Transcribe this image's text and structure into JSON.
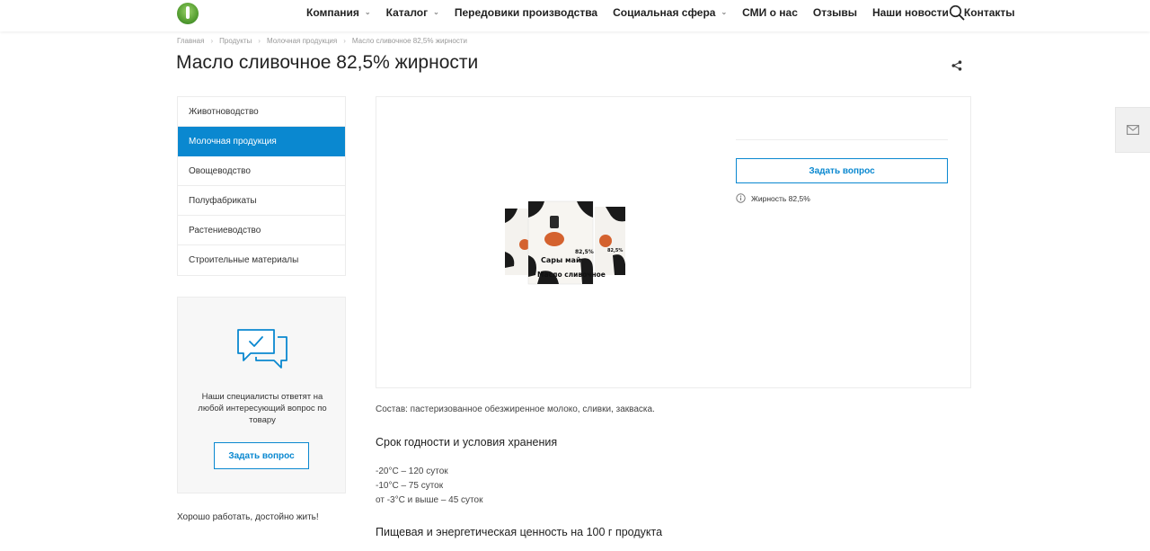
{
  "header": {
    "nav": [
      {
        "label": "Компания",
        "dropdown": true
      },
      {
        "label": "Каталог",
        "dropdown": true
      },
      {
        "label": "Передовики производства",
        "dropdown": false
      },
      {
        "label": "Социальная сфера",
        "dropdown": true
      },
      {
        "label": "СМИ о нас",
        "dropdown": false
      },
      {
        "label": "Отзывы",
        "dropdown": false
      },
      {
        "label": "Наши новости",
        "dropdown": false
      },
      {
        "label": "Контакты",
        "dropdown": false
      }
    ]
  },
  "breadcrumb": [
    "Главная",
    "Продукты",
    "Молочная продукция",
    "Масло сливочное 82,5% жирности"
  ],
  "page_title": "Масло сливочное 82,5% жирности",
  "sidebar": {
    "items": [
      {
        "label": "Животноводство",
        "active": false
      },
      {
        "label": "Молочная продукция",
        "active": true
      },
      {
        "label": "Овощеводство",
        "active": false
      },
      {
        "label": "Полуфабрикаты",
        "active": false
      },
      {
        "label": "Растениеводство",
        "active": false
      },
      {
        "label": "Строительные материалы",
        "active": false
      }
    ],
    "ask_text": "Наши специалисты ответят на любой интересующий вопрос по товару",
    "ask_button": "Задать вопрос",
    "slogan": "Хорошо работать, достойно жить!"
  },
  "product": {
    "ask_button": "Задать вопрос",
    "property": "Жирность 82,5%",
    "image_text": {
      "brand": "Сары май",
      "name": "Масло сливочное",
      "percent": "82,5%"
    }
  },
  "description": {
    "composition": "Состав: пастеризованное обезжиренное молоко, сливки, закваска.",
    "storage_title": "Срок годности и условия хранения",
    "storage_lines": [
      "-20°С – 120 суток",
      "-10°С – 75 суток",
      "от -3°С и выше – 45 суток"
    ],
    "nutrition_title": "Пищевая и энергетическая ценность на 100 г продукта"
  },
  "colors": {
    "accent": "#0a88d0"
  }
}
